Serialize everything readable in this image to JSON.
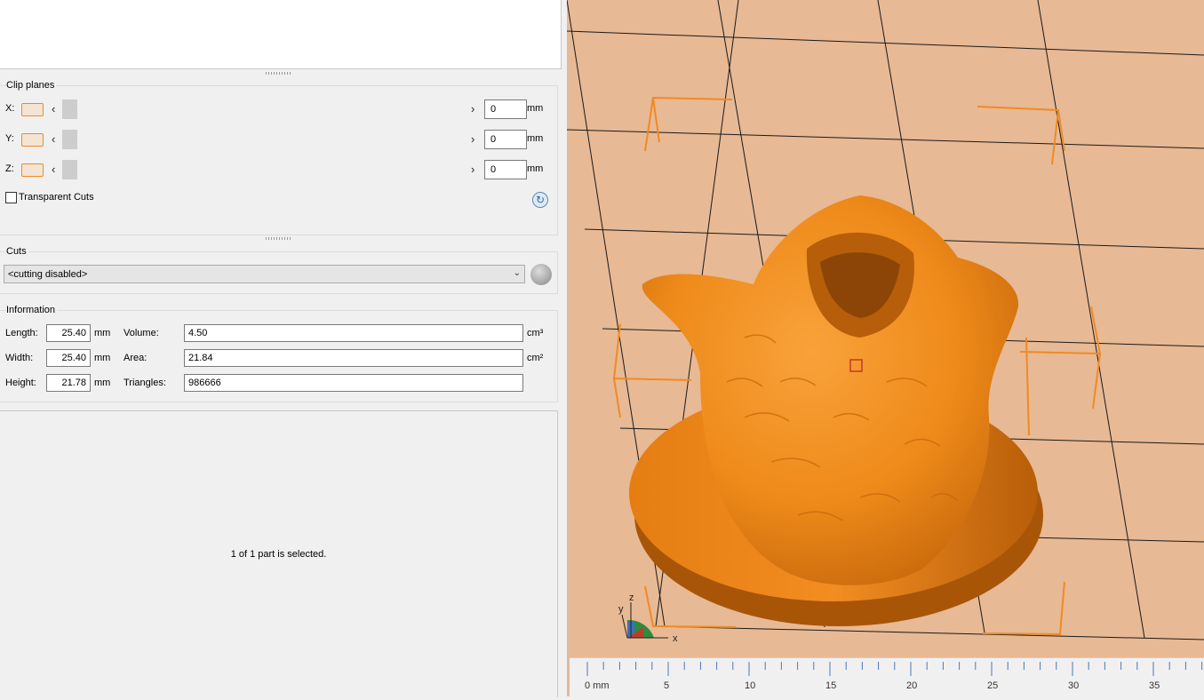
{
  "clip_planes": {
    "title": "Clip planes",
    "axes": [
      {
        "label": "X:",
        "value": "0",
        "unit": "mm"
      },
      {
        "label": "Y:",
        "value": "0",
        "unit": "mm"
      },
      {
        "label": "Z:",
        "value": "0",
        "unit": "mm"
      }
    ],
    "transparent_cuts_label": "Transparent Cuts",
    "transparent_cuts_checked": false
  },
  "cuts": {
    "title": "Cuts",
    "selected": "<cutting disabled>"
  },
  "information": {
    "title": "Information",
    "length_label": "Length:",
    "length_value": "25.40",
    "length_unit": "mm",
    "width_label": "Width:",
    "width_value": "25.40",
    "width_unit": "mm",
    "height_label": "Height:",
    "height_value": "21.78",
    "height_unit": "mm",
    "volume_label": "Volume:",
    "volume_value": "4.50",
    "volume_unit": "cm³",
    "area_label": "Area:",
    "area_value": "21.84",
    "area_unit": "cm²",
    "triangles_label": "Triangles:",
    "triangles_value": "986666"
  },
  "status_text": "1 of 1 part is selected.",
  "viewport": {
    "model_color": "#f28a1c",
    "bed_color": "#e7b994",
    "axis_labels": {
      "x": "x",
      "y": "y",
      "z": "z"
    }
  },
  "ruler": {
    "labels": [
      "0 mm",
      "5",
      "10",
      "15",
      "20",
      "25",
      "30",
      "35"
    ]
  }
}
